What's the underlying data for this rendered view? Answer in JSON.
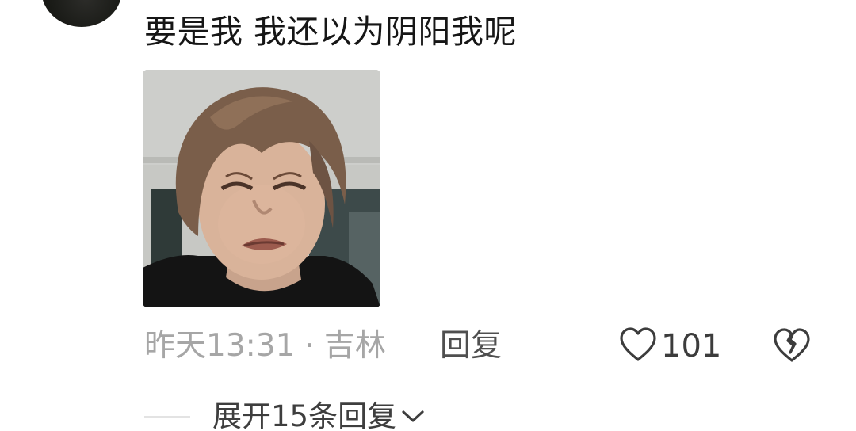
{
  "comment": {
    "text": "要是我 我还以为阴阳我呢",
    "time": "昨天13:31",
    "separator": "·",
    "location": "吉林",
    "reply_label": "回复",
    "like_count": "101"
  },
  "expand": {
    "label": "展开15条回复"
  },
  "icons": {
    "like": "heart-outline-icon",
    "dislike": "broken-heart-icon",
    "expand": "chevron-down-icon"
  },
  "colors": {
    "primary_text": "#161616",
    "secondary_text": "#a6a6a6",
    "action_text": "#4f4f4f"
  }
}
